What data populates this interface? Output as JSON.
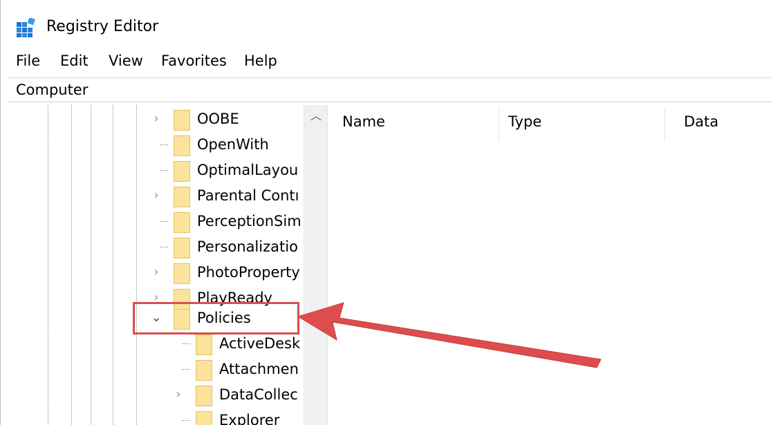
{
  "window": {
    "title": "Registry Editor",
    "icon": "registry-editor-icon"
  },
  "menu": [
    {
      "label": "File"
    },
    {
      "label": "Edit"
    },
    {
      "label": "View"
    },
    {
      "label": "Favorites"
    },
    {
      "label": "Help"
    }
  ],
  "address": {
    "path": "Computer"
  },
  "tree": {
    "items": [
      {
        "label": "OOBE",
        "expander": "collapsed"
      },
      {
        "label": "OpenWith",
        "expander": "none"
      },
      {
        "label": "OptimalLayou",
        "expander": "none"
      },
      {
        "label": "Parental Contı",
        "expander": "collapsed"
      },
      {
        "label": "PerceptionSim",
        "expander": "none"
      },
      {
        "label": "Personalizatio",
        "expander": "none"
      },
      {
        "label": "PhotoProperty",
        "expander": "collapsed"
      },
      {
        "label": "PlayReady",
        "expander": "collapsed"
      },
      {
        "label": "Policies",
        "expander": "expanded",
        "highlighted": true
      },
      {
        "label": "ActiveDesk",
        "expander": "none"
      },
      {
        "label": "Attachmen",
        "expander": "none"
      },
      {
        "label": "DataCollec",
        "expander": "collapsed"
      },
      {
        "label": "Explorer",
        "expander": "none"
      }
    ]
  },
  "list": {
    "columns": [
      "Name",
      "Type",
      "Data"
    ]
  },
  "annotation": {
    "color": "#dd4d4d",
    "shape": "arrow-pointing-left"
  }
}
